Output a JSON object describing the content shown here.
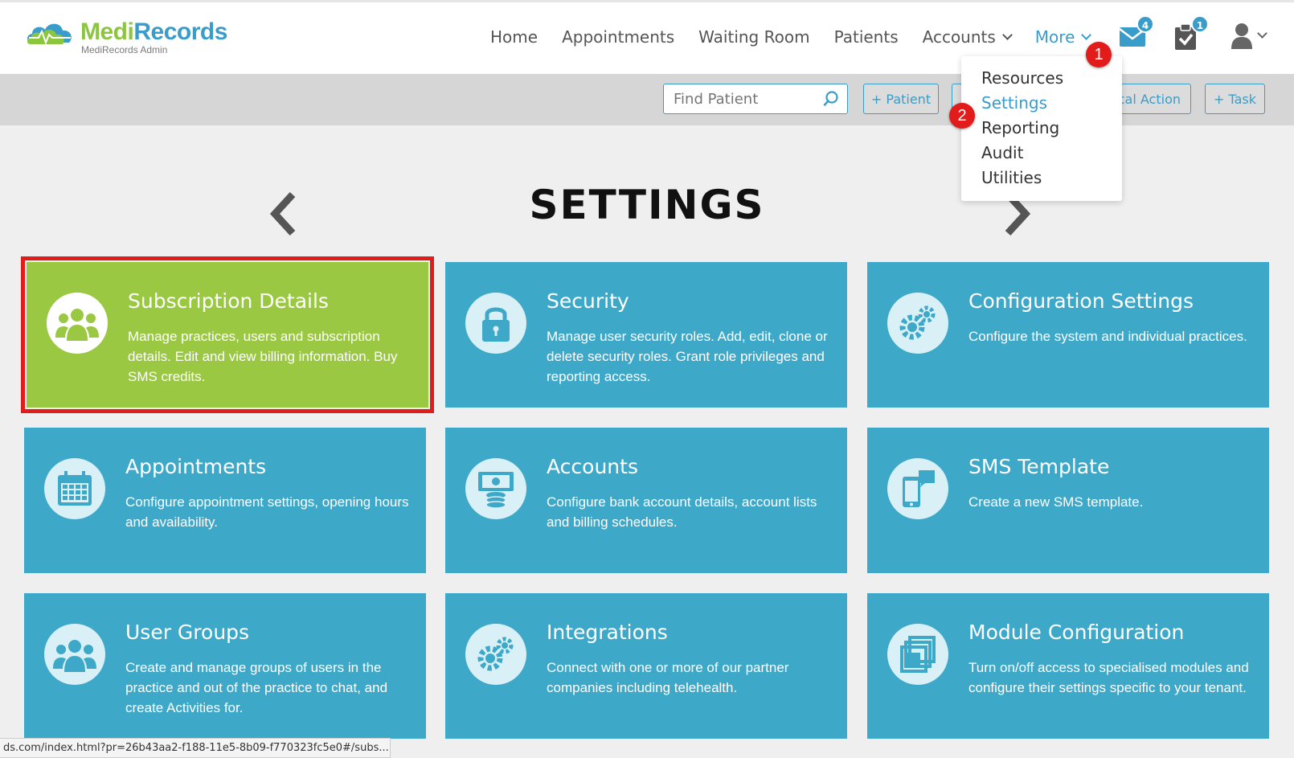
{
  "app": {
    "brand_part1": "Medi",
    "brand_part2": "Records",
    "subtitle": "MediRecords Admin"
  },
  "nav": {
    "home": "Home",
    "appointments": "Appointments",
    "waiting_room": "Waiting Room",
    "patients": "Patients",
    "accounts": "Accounts",
    "more": "More"
  },
  "badges": {
    "messages": "4",
    "tasks": "1"
  },
  "toolbar": {
    "search_placeholder": "Find Patient",
    "add_patient": "+ Patient",
    "clinical_action": "ical Action",
    "add_task": "+ Task"
  },
  "more_menu": {
    "items": [
      "Resources",
      "Settings",
      "Reporting",
      "Audit",
      "Utilities"
    ],
    "active": "Settings"
  },
  "steps": [
    "1",
    "2"
  ],
  "page": {
    "title": "SETTINGS"
  },
  "cards": [
    {
      "title": "Subscription Details",
      "desc": "Manage practices, users and subscription details. Edit and view billing information. Buy SMS credits.",
      "icon": "users-icon"
    },
    {
      "title": "Security",
      "desc": "Manage user security roles. Add, edit, clone or delete security roles. Grant role privileges and reporting access.",
      "icon": "lock-icon"
    },
    {
      "title": "Configuration Settings",
      "desc": "Configure the system and individual practices.",
      "icon": "gears-icon"
    },
    {
      "title": "Appointments",
      "desc": "Configure appointment settings, opening hours and availability.",
      "icon": "calendar-icon"
    },
    {
      "title": "Accounts",
      "desc": "Configure bank account details, account lists and billing schedules.",
      "icon": "money-icon"
    },
    {
      "title": "SMS Template",
      "desc": "Create a new SMS template.",
      "icon": "phone-message-icon"
    },
    {
      "title": "User Groups",
      "desc": "Create and manage groups of users in the practice and out of the practice to chat, and create Activities for.",
      "icon": "user-group-icon"
    },
    {
      "title": "Integrations",
      "desc": "Connect with one or more of our partner companies including telehealth.",
      "icon": "gears-icon"
    },
    {
      "title": "Module Configuration",
      "desc": "Turn on/off access to specialised modules and configure their settings specific to your tenant.",
      "icon": "modules-icon"
    }
  ],
  "colors": {
    "accent": "#3a9cc9",
    "card_blue": "#3ea8c9",
    "card_green": "#9ac842",
    "highlight_red": "#e21b1b"
  },
  "statusbar": {
    "url": "ds.com/index.html?pr=26b43aa2-f188-11e5-8b09-f770323fc5e0#/subs..."
  }
}
